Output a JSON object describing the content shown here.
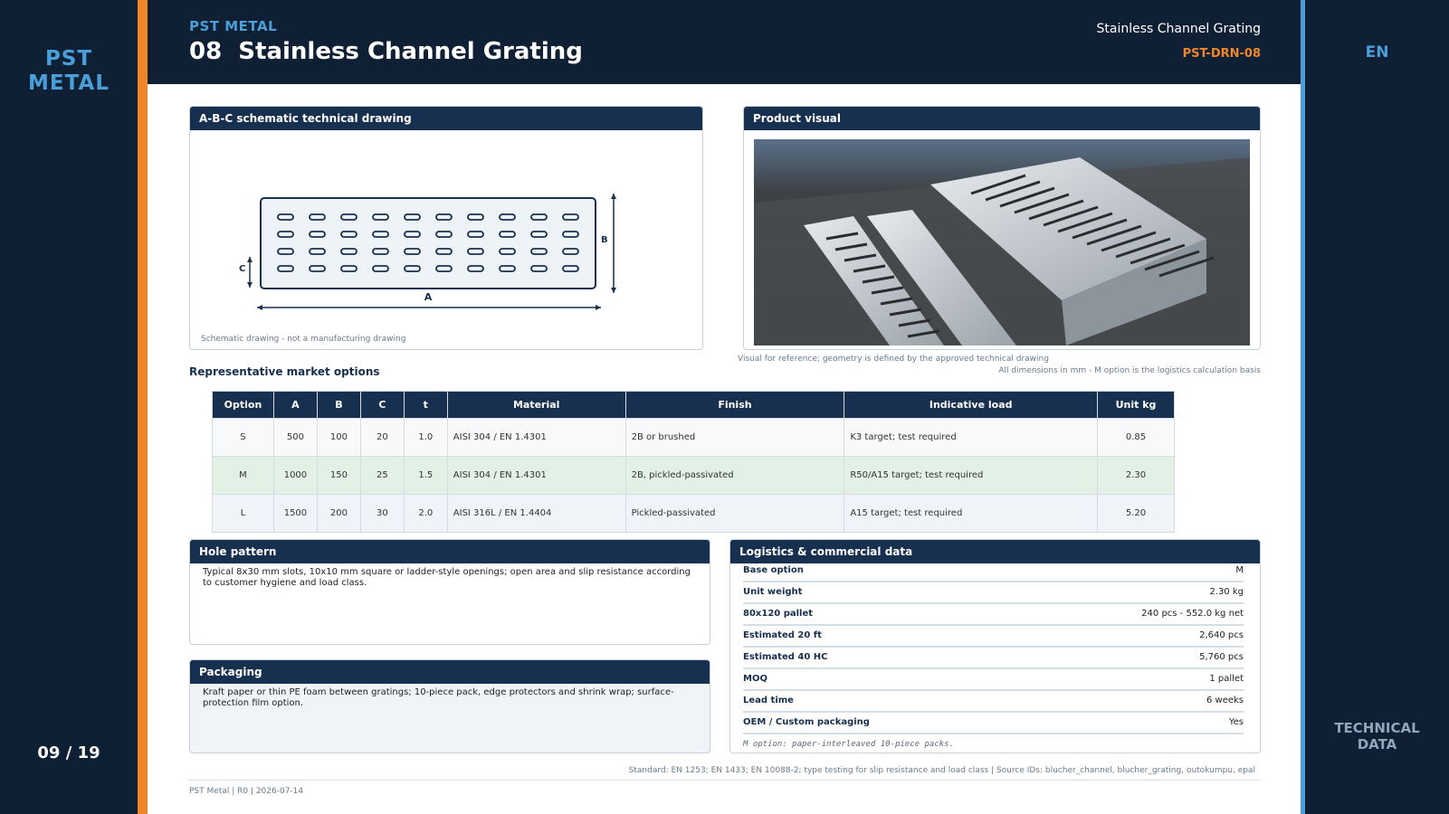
{
  "brand": {
    "logo_line1": "PST",
    "logo_line2": "METAL",
    "kicker": "PST METAL"
  },
  "page": {
    "count": "09 / 19",
    "lang": "EN",
    "section_line1": "TECHNICAL",
    "section_line2": "DATA"
  },
  "header": {
    "title": "08  Stainless Channel Grating",
    "subtitle": "Stainless Channel Grating",
    "doc_code": "PST-DRN-08"
  },
  "drawing_panel": {
    "title": "A-B-C schematic technical drawing",
    "label_a": "A",
    "label_b": "B",
    "label_c": "C",
    "caption": "Schematic drawing - not a manufacturing drawing"
  },
  "visual_panel": {
    "title": "Product visual",
    "caption": "Visual for reference; geometry is defined by the approved technical drawing"
  },
  "dims_note": "All dimensions in mm - M option is the logistics calculation basis",
  "options": {
    "title": "Representative market options",
    "headers": [
      "Option",
      "A",
      "B",
      "C",
      "t",
      "Material",
      "Finish",
      "Indicative load",
      "Unit kg"
    ],
    "rows": [
      [
        "S",
        "500",
        "100",
        "20",
        "1.0",
        "AISI 304 / EN 1.4301",
        "2B or brushed",
        "K3 target; test required",
        "0.85"
      ],
      [
        "M",
        "1000",
        "150",
        "25",
        "1.5",
        "AISI 304 / EN 1.4301",
        "2B, pickled-passivated",
        "R50/A15 target; test required",
        "2.30"
      ],
      [
        "L",
        "1500",
        "200",
        "30",
        "2.0",
        "AISI 316L / EN 1.4404",
        "Pickled-passivated",
        "A15 target; test required",
        "5.20"
      ]
    ]
  },
  "hole_pattern": {
    "title": "Hole pattern",
    "text": "Typical 8x30 mm slots, 10x10 mm square or ladder-style openings; open area and slip resistance according to customer hygiene and load class."
  },
  "packaging": {
    "title": "Packaging",
    "text": "Kraft paper or thin PE foam between gratings; 10-piece pack, edge protectors and shrink wrap; surface-protection film option."
  },
  "logistics": {
    "title": "Logistics & commercial data",
    "rows": [
      {
        "key": "Base option",
        "value": "M"
      },
      {
        "key": "Unit weight",
        "value": "2.30 kg"
      },
      {
        "key": "80x120 pallet",
        "value": "240 pcs - 552.0 kg net"
      },
      {
        "key": "Estimated 20 ft",
        "value": "2,640 pcs"
      },
      {
        "key": "Estimated 40 HC",
        "value": "5,760 pcs"
      },
      {
        "key": "MOQ",
        "value": "1 pallet"
      },
      {
        "key": "Lead time",
        "value": "6 weeks"
      },
      {
        "key": "OEM / Custom packaging",
        "value": "Yes"
      }
    ],
    "note": "M option: paper-interleaved 10-piece packs."
  },
  "footer": {
    "standard": "Standard: EN 1253; EN 1433; EN 10088-2; type testing for slip resistance and load class | Source IDs: blucher_channel, blucher_grating, outokumpu, epal",
    "meta": "PST Metal | R0 | 2026-07-14"
  },
  "colors": {
    "navy": "#0f2035",
    "panel_navy": "#17304f",
    "accent_orange": "#f0862a",
    "accent_blue": "#4a9fd8",
    "row_highlight": "#e2f0e6"
  }
}
